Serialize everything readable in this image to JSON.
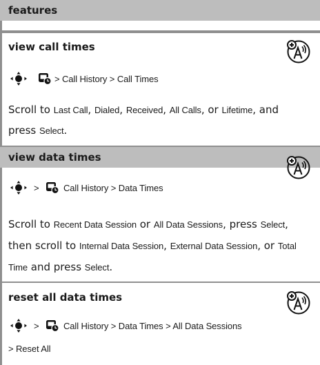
{
  "header": "features",
  "sections": [
    {
      "title": "view call times",
      "path": {
        "sep": ">",
        "p1": "Call History",
        "p2": "Call Times"
      },
      "body": {
        "scroll_to": "Scroll to",
        "opt1": "Last Call",
        "comma": ",",
        "opt2": "Dialed",
        "opt3": "Received",
        "opt4": "All Calls",
        "or": ", or",
        "opt5": "Lifetime",
        "and": ", and",
        "press": "press",
        "select": "Select",
        "period": "."
      }
    },
    {
      "title": "view data times",
      "path": {
        "sep": ">",
        "p1": "Call History",
        "p2": "Data Times"
      },
      "body": {
        "scroll_to": "Scroll to",
        "opt1": "Recent Data Session",
        "or1": "or",
        "opt2": "All Data Sessions",
        "press": ", press",
        "select": "Select",
        "comma": ",",
        "then": "then scroll to",
        "opt3": "Internal Data Session",
        "opt4": "External Data Session",
        "or2": ", or",
        "total": "Total",
        "time": "Time",
        "and_press": "and press",
        "period": "."
      }
    },
    {
      "title": "reset all data times",
      "path": {
        "sep": ">",
        "p1": "Call History",
        "p2": "Data Times",
        "p3": "All Data Sessions",
        "p4": "Reset All"
      }
    }
  ],
  "icons": {
    "nav": "navigation-key-icon",
    "menu": "recent-calls-menu-icon",
    "network": "network-feature-icon"
  }
}
